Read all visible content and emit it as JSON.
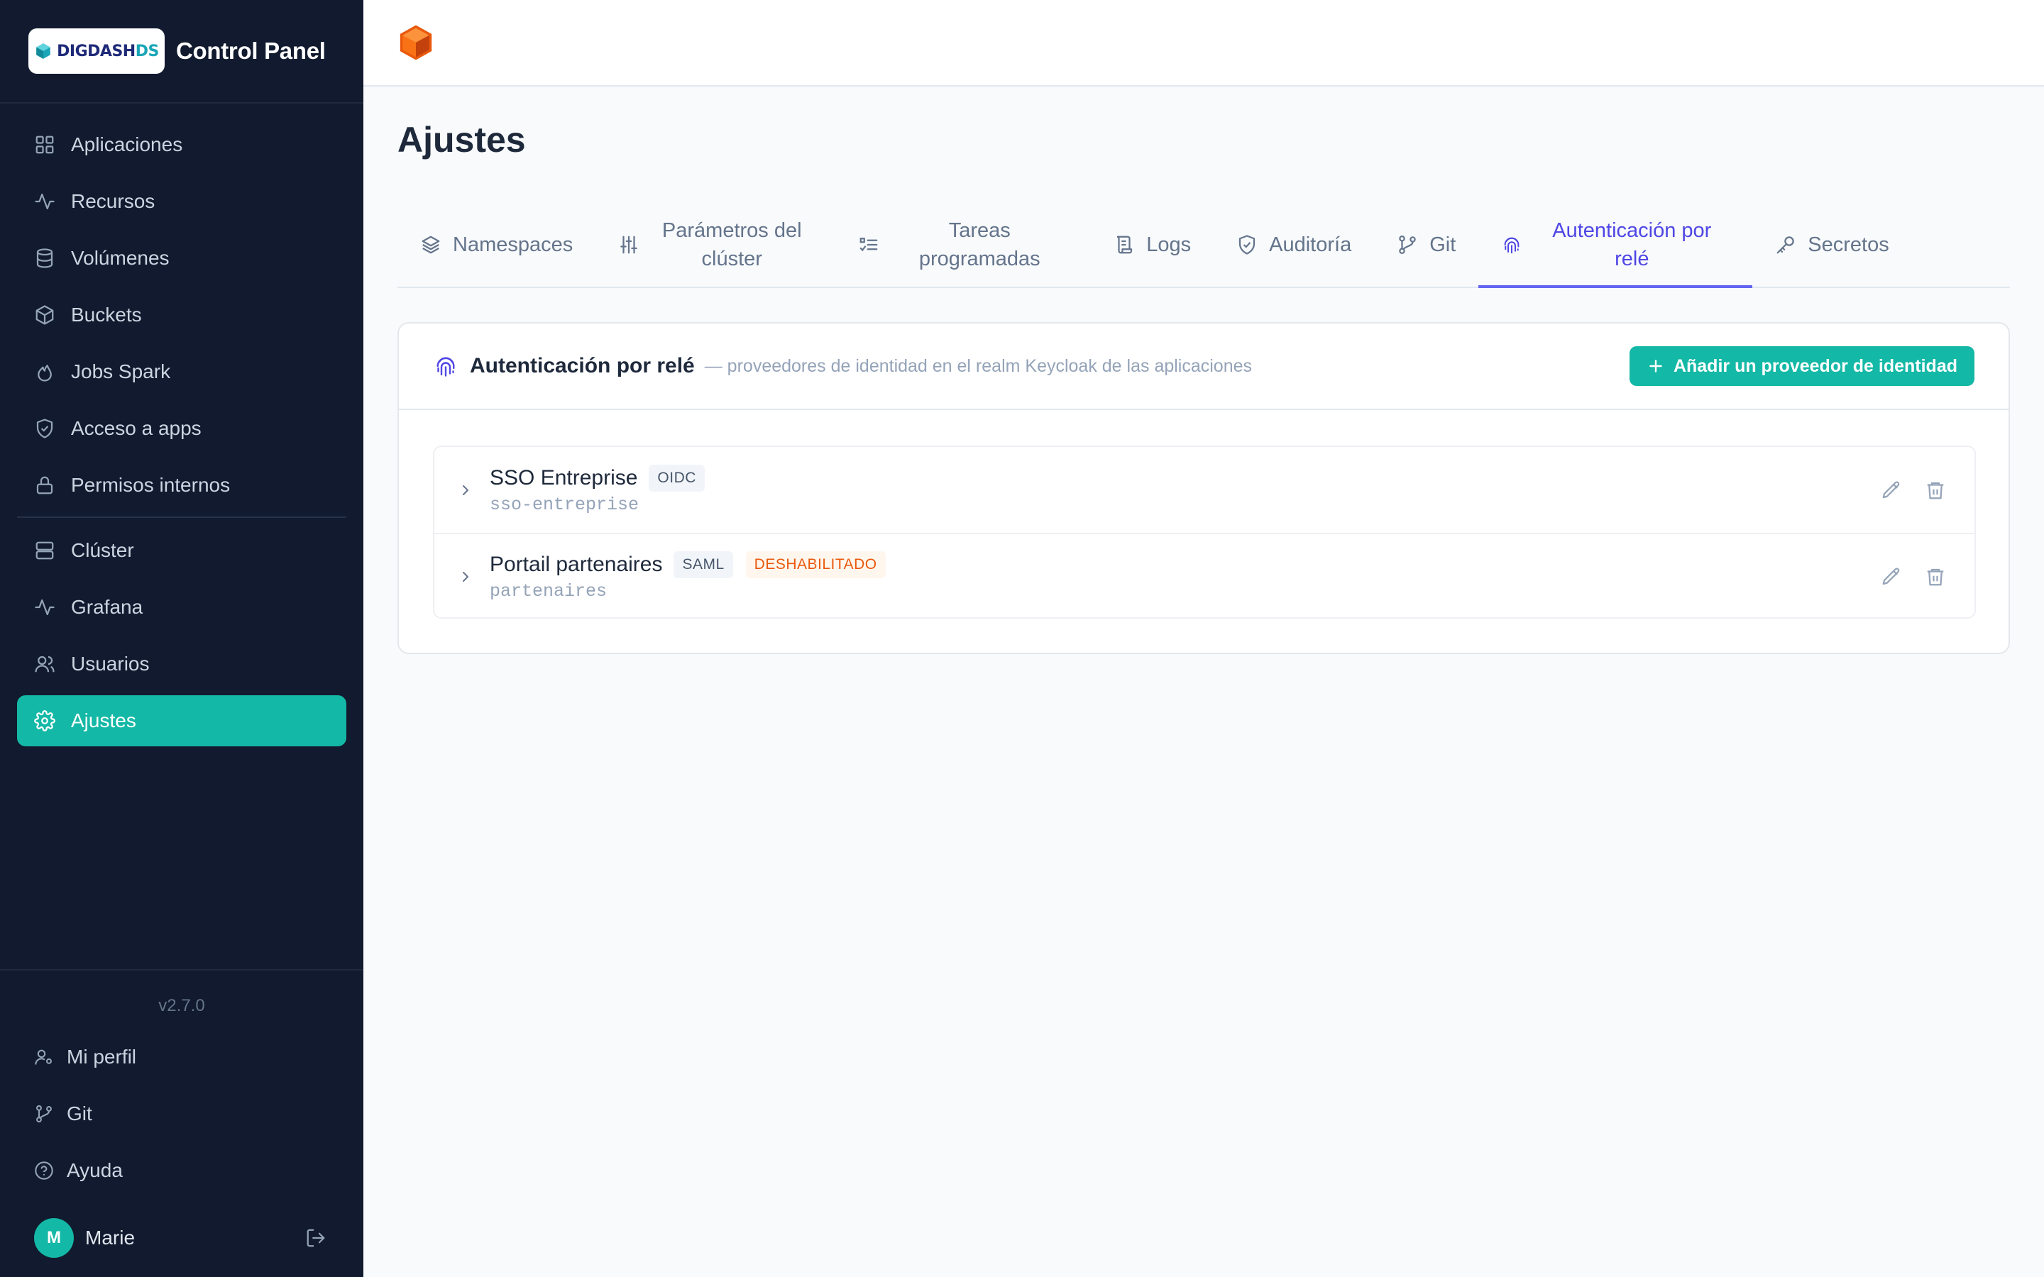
{
  "sidebar": {
    "logo_text": "DIGDASH",
    "logo_suffix": "DS",
    "app_title": "Control Panel",
    "nav_primary": [
      {
        "label": "Aplicaciones",
        "icon": "grid-icon"
      },
      {
        "label": "Recursos",
        "icon": "activity-icon"
      },
      {
        "label": "Volúmenes",
        "icon": "database-icon"
      },
      {
        "label": "Buckets",
        "icon": "box-icon"
      },
      {
        "label": "Jobs Spark",
        "icon": "flame-icon"
      },
      {
        "label": "Acceso a apps",
        "icon": "shield-check-icon"
      },
      {
        "label": "Permisos internos",
        "icon": "lock-icon"
      }
    ],
    "nav_secondary": [
      {
        "label": "Clúster",
        "icon": "server-icon"
      },
      {
        "label": "Grafana",
        "icon": "activity-icon"
      },
      {
        "label": "Usuarios",
        "icon": "users-icon"
      },
      {
        "label": "Ajustes",
        "icon": "gear-icon",
        "active": true
      }
    ],
    "version": "v2.7.0",
    "footer": [
      {
        "label": "Mi perfil",
        "icon": "user-cog-icon"
      },
      {
        "label": "Git",
        "icon": "git-branch-icon"
      },
      {
        "label": "Ayuda",
        "icon": "help-circle-icon"
      }
    ],
    "user": {
      "initial": "M",
      "name": "Marie"
    }
  },
  "page": {
    "title": "Ajustes"
  },
  "tabs": [
    {
      "label": "Namespaces",
      "icon": "layers-icon"
    },
    {
      "label": "Parámetros del clúster",
      "icon": "sliders-icon"
    },
    {
      "label": "Tareas programadas",
      "icon": "list-checks-icon"
    },
    {
      "label": "Logs",
      "icon": "scroll-icon"
    },
    {
      "label": "Auditoría",
      "icon": "shield-icon"
    },
    {
      "label": "Git",
      "icon": "git-branch-icon"
    },
    {
      "label": "Autenticación por relé",
      "icon": "fingerprint-icon",
      "active": true
    },
    {
      "label": "Secretos",
      "icon": "key-icon"
    }
  ],
  "panel": {
    "title": "Autenticación por relé",
    "subtitle": "— proveedores de identidad en el realm Keycloak de las aplicaciones",
    "add_button": "Añadir un proveedor de identidad"
  },
  "providers": [
    {
      "name": "SSO Entreprise",
      "protocol": "OIDC",
      "slug": "sso-entreprise",
      "status": ""
    },
    {
      "name": "Portail partenaires",
      "protocol": "SAML",
      "slug": "partenaires",
      "status": "DESHABILITADO"
    }
  ],
  "colors": {
    "sidebar_bg": "#111a2e",
    "accent": "#14b8a6",
    "active_tab": "#4f46e5",
    "disabled_badge": "#ea580c"
  }
}
